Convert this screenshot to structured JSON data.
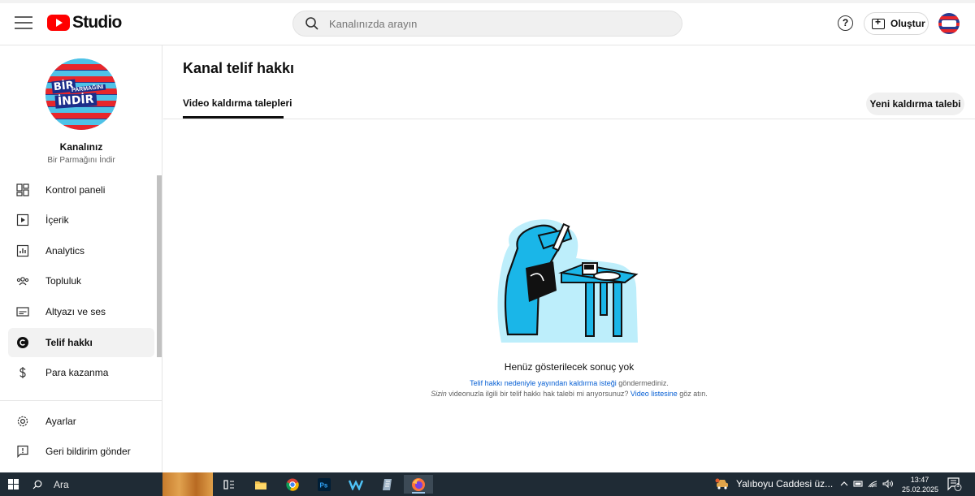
{
  "header": {
    "logo_text": "Studio",
    "search_placeholder": "Kanalınızda arayın",
    "help_glyph": "?",
    "create_label": "Oluştur"
  },
  "sidebar": {
    "channel_title": "Kanalınız",
    "channel_name": "Bir Parmağını İndir",
    "avatar_lettering": [
      "BİR",
      "PARMAĞINI",
      "İNDİR"
    ],
    "items": [
      {
        "label": "Kontrol paneli",
        "icon": "dashboard-icon"
      },
      {
        "label": "İçerik",
        "icon": "content-icon"
      },
      {
        "label": "Analytics",
        "icon": "analytics-icon"
      },
      {
        "label": "Topluluk",
        "icon": "community-icon"
      },
      {
        "label": "Altyazı ve ses",
        "icon": "subtitles-icon"
      },
      {
        "label": "Telif hakkı",
        "icon": "copyright-icon",
        "active": true
      },
      {
        "label": "Para kazanma",
        "icon": "dollar-icon"
      }
    ],
    "footer_items": [
      {
        "label": "Ayarlar",
        "icon": "gear-icon"
      },
      {
        "label": "Geri bildirim gönder",
        "icon": "feedback-icon"
      }
    ]
  },
  "main": {
    "title": "Kanal telif hakkı",
    "tab_label": "Video kaldırma talepleri",
    "new_request_label": "Yeni kaldırma talebi",
    "empty": {
      "title": "Henüz gösterilecek sonuç yok",
      "line1_link": "Telif hakkı nedeniyle yayından kaldırma isteği",
      "line1_rest": " göndermediniz.",
      "line2_em": "Sizin",
      "line2_rest": " videonuzla ilgili bir telif hakkı hak talebi mi arıyorsunuz? ",
      "line2_link": "Video listesine",
      "line2_end": " göz atın."
    }
  },
  "taskbar": {
    "search_label": "Ara",
    "weather_text": "Yalıboyu Caddesi üz...",
    "time": "13:47",
    "date": "25.02.2025",
    "notification_count": "1",
    "apps": [
      "task-view-icon",
      "file-explorer-icon",
      "chrome-icon",
      "photoshop-icon",
      "app-icon",
      "notes-icon",
      "firefox-icon"
    ]
  },
  "colors": {
    "brand_red": "#ff0000",
    "link": "#065fd4",
    "illustration_cyan": "#1ab6e8",
    "taskbar_bg": "#1f2b35"
  }
}
